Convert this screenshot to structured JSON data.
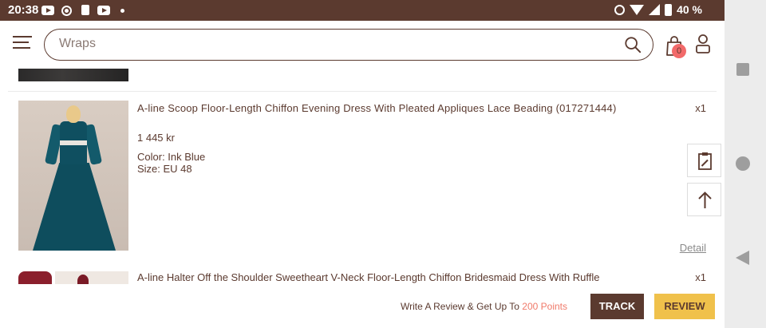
{
  "status_bar": {
    "time": "20:38",
    "battery": "40 %"
  },
  "header": {
    "search_placeholder": "Wraps",
    "cart_count": "0"
  },
  "orders": [
    {
      "title": "A-line Scoop Floor-Length Chiffon Evening Dress With Pleated Appliques Lace Beading (017271444)",
      "quantity": "x1",
      "price": "1 445 kr",
      "color": "Color: Ink Blue",
      "size": "Size: EU 48",
      "detail_label": "Detail"
    },
    {
      "title": "A-line Halter Off the Shoulder Sweetheart V-Neck Floor-Length Chiffon Bridesmaid Dress With Ruffle",
      "quantity": "x1"
    }
  ],
  "bottom_bar": {
    "review_text": "Write A Review & Get Up To ",
    "review_points": "200 Points",
    "track_label": "TRACK",
    "review_label": "REVIEW"
  },
  "colors": {
    "brand": "#5b3a2f",
    "review_button": "#f0c14b",
    "points": "#f07a6a",
    "badge": "#f26a6a"
  }
}
